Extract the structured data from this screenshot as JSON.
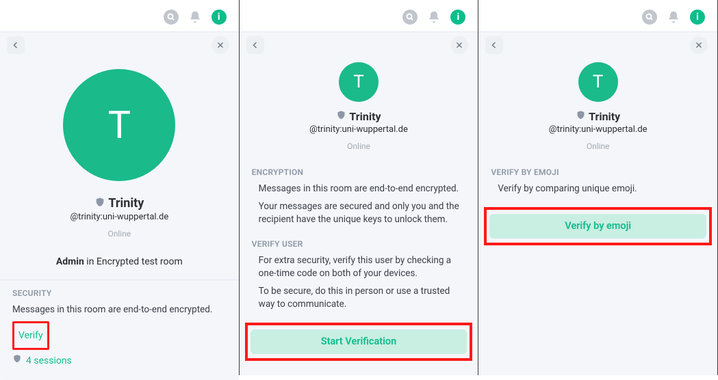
{
  "user": {
    "avatar_letter": "T",
    "display_name": "Trinity",
    "handle": "@trinity:uni-wuppertal.de",
    "presence": "Online"
  },
  "panel1": {
    "role_label_strong": "Admin",
    "role_label_rest": " in Encrypted test room",
    "security_header": "SECURITY",
    "security_text": "Messages in this room are end-to-end encrypted.",
    "verify_link": "Verify",
    "sessions_text": "4 sessions"
  },
  "panel2": {
    "encryption_header": "ENCRYPTION",
    "encryption_p1": "Messages in this room are end-to-end encrypted.",
    "encryption_p2": "Your messages are secured and only you and the recipient have the unique keys to unlock them.",
    "verify_user_header": "VERIFY USER",
    "verify_p1": "For extra security, verify this user by checking a one-time code on both of your devices.",
    "verify_p2": "To be secure, do this in person or use a trusted way to communicate.",
    "start_button": "Start Verification"
  },
  "panel3": {
    "verify_emoji_header": "VERIFY BY EMOJI",
    "verify_emoji_text": "Verify by comparing unique emoji.",
    "emoji_button": "Verify by emoji"
  }
}
